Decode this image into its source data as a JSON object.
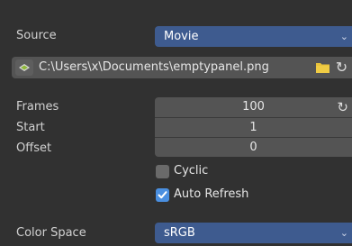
{
  "source": {
    "label": "Source",
    "value": "Movie"
  },
  "path": {
    "value": "C:\\Users\\x\\Documents\\emptypanel.png"
  },
  "frames": {
    "label": "Frames",
    "value": "100"
  },
  "start": {
    "label": "Start",
    "value": "1"
  },
  "offset": {
    "label": "Offset",
    "value": "0"
  },
  "cyclic": {
    "label": "Cyclic",
    "checked": false
  },
  "auto_refresh": {
    "label": "Auto Refresh",
    "checked": true
  },
  "color_space": {
    "label": "Color Space",
    "value": "sRGB"
  },
  "colors": {
    "accent": "#3e5b8f",
    "field": "#545454",
    "background": "#313131",
    "checkbox_on": "#4a8fe0",
    "folder": "#e8c23a"
  }
}
